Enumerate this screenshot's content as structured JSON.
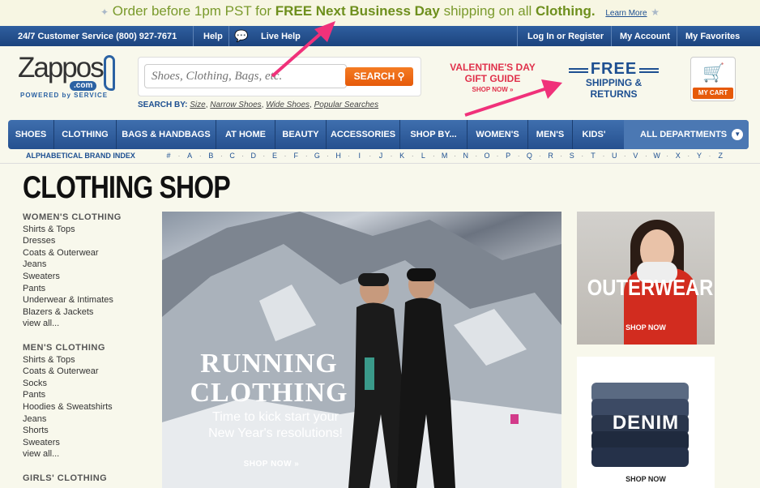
{
  "promo": {
    "part1": "Order before 1pm PST for ",
    "bold1": "FREE Next Business Day",
    "part2": " shipping on all ",
    "bold2": "Clothing.",
    "learn_more": "Learn More"
  },
  "topbar": {
    "customer_service": "24/7 Customer Service (800) 927-7671",
    "help": "Help",
    "live_help": "Live Help",
    "login": "Log In or Register",
    "account": "My Account",
    "favorites": "My Favorites"
  },
  "logo": {
    "name": "Zappos",
    "com": ".com",
    "tagline": "POWERED by SERVICE"
  },
  "search": {
    "placeholder": "Shoes, Clothing, Bags, etc.",
    "button": "SEARCH",
    "search_by_label": "SEARCH BY:",
    "options": [
      "Size",
      "Narrow Shoes",
      "Wide Shoes",
      "Popular Searches"
    ]
  },
  "valentine": {
    "line1": "VALENTINE'S DAY",
    "line2": "GIFT GUIDE",
    "shop": "SHOP NOW »"
  },
  "free_shipping": {
    "line1": "FREE",
    "line2": "SHIPPING & RETURNS"
  },
  "cart": {
    "label": "MY CART"
  },
  "nav": {
    "items": [
      "SHOES",
      "CLOTHING",
      "BAGS & HANDBAGS",
      "AT HOME",
      "BEAUTY",
      "ACCESSORIES",
      "SHOP BY...",
      "WOMEN'S",
      "MEN'S",
      "KIDS'"
    ],
    "all_departments": "ALL DEPARTMENTS"
  },
  "alpha": {
    "title": "ALPHABETICAL BRAND INDEX",
    "letters": [
      "#",
      "A",
      "B",
      "C",
      "D",
      "E",
      "F",
      "G",
      "H",
      "I",
      "J",
      "K",
      "L",
      "M",
      "N",
      "O",
      "P",
      "Q",
      "R",
      "S",
      "T",
      "U",
      "V",
      "W",
      "X",
      "Y",
      "Z"
    ]
  },
  "page_title": "CLOTHING SHOP",
  "sidebar": {
    "womens": {
      "heading": "WOMEN'S CLOTHING",
      "items": [
        "Shirts & Tops",
        "Dresses",
        "Coats & Outerwear",
        "Jeans",
        "Sweaters",
        "Pants",
        "Underwear & Intimates",
        "Blazers & Jackets",
        "view all..."
      ]
    },
    "mens": {
      "heading": "MEN'S CLOTHING",
      "items": [
        "Shirts & Tops",
        "Coats & Outerwear",
        "Socks",
        "Pants",
        "Hoodies & Sweatshirts",
        "Jeans",
        "Shorts",
        "Sweaters",
        "view all..."
      ]
    },
    "girls": {
      "heading": "GIRLS' CLOTHING"
    }
  },
  "hero": {
    "title1": "RUNNING",
    "title2": "CLOTHING",
    "sub1": "Time to kick start your",
    "sub2": "New Year's resolutions!",
    "shop": "SHOP NOW »"
  },
  "outerwear": {
    "title": "OUTERWEAR",
    "shop": "SHOP NOW"
  },
  "denim": {
    "title": "DENIM",
    "shop": "SHOP NOW"
  },
  "colors": {
    "brand_blue": "#1d4f91",
    "orange": "#e65a0a",
    "promo_green": "#7a9a2c",
    "valentine_red": "#e0314b",
    "arrow_pink": "#f0317a"
  }
}
